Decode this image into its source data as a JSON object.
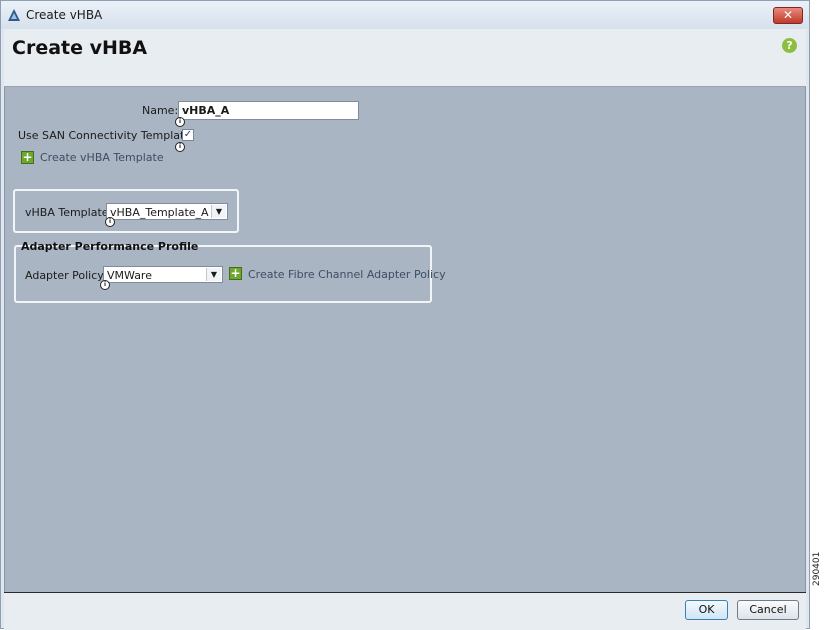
{
  "window": {
    "title": "Create vHBA",
    "close_label": "✕"
  },
  "header": {
    "title": "Create vHBA",
    "help_icon": "?"
  },
  "form": {
    "name_label": "Name:",
    "name_value": "vHBA_A",
    "use_template_label": "Use SAN Connectivity Template:",
    "use_template_checked": "✓",
    "create_template_link": "Create vHBA Template",
    "vhba_template_label": "vHBA Template:",
    "vhba_template_value": "vHBA_Template_A",
    "adapter_group_title": "Adapter Performance Profile",
    "adapter_policy_label": "Adapter Policy:",
    "adapter_policy_value": "VMWare",
    "create_adapter_policy_link": "Create Fibre Channel Adapter Policy",
    "info_glyph": "i",
    "plus_glyph": "+",
    "dropdown_glyph": "▼"
  },
  "footer": {
    "ok_label": "OK",
    "cancel_label": "Cancel"
  },
  "figure_id": "290401",
  "icons": {
    "app": "cisco-triangle-icon",
    "help": "help-icon",
    "close": "close-icon",
    "add": "plus-icon",
    "info": "info-icon",
    "dropdown": "chevron-down-icon"
  },
  "colors": {
    "content_bg": "#a9b5c2",
    "header_bg": "#e8edf2",
    "accent_green": "#6ea72e",
    "close_red": "#c0392b"
  }
}
